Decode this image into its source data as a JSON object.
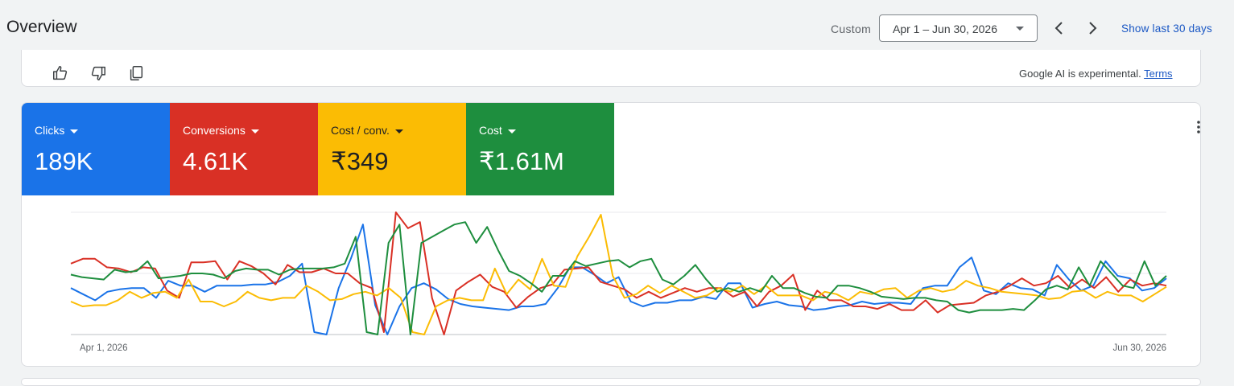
{
  "header": {
    "title": "Overview",
    "custom_label": "Custom",
    "date_range": "Apr 1 – Jun 30, 2026",
    "show_last": "Show last 30 days",
    "prev_icon": "chevron-left-icon",
    "next_icon": "chevron-right-icon"
  },
  "ai_feedback": {
    "icons": [
      "thumbs-up-icon",
      "thumbs-down-icon",
      "copy-icon"
    ],
    "note": "Google AI is experimental.",
    "terms_link": "Terms"
  },
  "metrics": [
    {
      "label": "Clicks",
      "value": "189K",
      "color": "#1a73e8"
    },
    {
      "label": "Conversions",
      "value": "4.61K",
      "color": "#d93025"
    },
    {
      "label": "Cost / conv.",
      "value": "₹349",
      "color": "#fbbc04"
    },
    {
      "label": "Cost",
      "value": "₹1.61M",
      "color": "#1e8e3e"
    }
  ],
  "chart_data": {
    "type": "line",
    "x_start_label": "Apr 1, 2026",
    "x_end_label": "Jun 30, 2026",
    "ylim": [
      0,
      100
    ],
    "grid": true,
    "series": [
      {
        "name": "Clicks",
        "color": "#1a73e8",
        "values": [
          38,
          33,
          28,
          35,
          37,
          38,
          38,
          30,
          44,
          40,
          40,
          35,
          40,
          40,
          40,
          41,
          41,
          43,
          48,
          58,
          2,
          0,
          38,
          62,
          90,
          24,
          0,
          23,
          38,
          42,
          37,
          29,
          25,
          23,
          22,
          21,
          20,
          23,
          23,
          25,
          38,
          55,
          55,
          49,
          42,
          47,
          27,
          23,
          26,
          26,
          28,
          28,
          31,
          29,
          42,
          42,
          22,
          25,
          27,
          24,
          23,
          20,
          21,
          23,
          24,
          27,
          25,
          26,
          26,
          25,
          38,
          40,
          40,
          55,
          63,
          36,
          33,
          42,
          38,
          37,
          32,
          57,
          45,
          36,
          40,
          60,
          48,
          46,
          36,
          38,
          46
        ]
      },
      {
        "name": "Conversions",
        "color": "#d93025",
        "values": [
          58,
          62,
          62,
          55,
          54,
          51,
          55,
          54,
          36,
          30,
          59,
          59,
          60,
          45,
          60,
          56,
          50,
          41,
          57,
          51,
          51,
          54,
          50,
          50,
          42,
          38,
          2,
          100,
          87,
          92,
          30,
          0,
          36,
          43,
          49,
          39,
          35,
          22,
          31,
          38,
          41,
          53,
          54,
          55,
          43,
          40,
          37,
          30,
          35,
          30,
          34,
          38,
          35,
          38,
          38,
          31,
          35,
          23,
          35,
          40,
          49,
          20,
          36,
          28,
          28,
          23,
          23,
          21,
          25,
          20,
          20,
          28,
          18,
          24,
          25,
          26,
          32,
          35,
          40,
          46,
          40,
          42,
          48,
          38,
          45,
          38,
          47,
          35,
          45,
          40,
          42,
          40
        ]
      },
      {
        "name": "Cost / conv.",
        "color": "#fbbc04",
        "values": [
          27,
          23,
          24,
          24,
          28,
          35,
          30,
          34,
          35,
          30,
          45,
          27,
          27,
          23,
          27,
          35,
          30,
          28,
          30,
          30,
          40,
          35,
          28,
          29,
          33,
          35,
          32,
          38,
          30,
          2,
          0,
          23,
          28,
          30,
          28,
          28,
          54,
          33,
          45,
          37,
          62,
          40,
          39,
          64,
          80,
          98,
          48,
          30,
          33,
          40,
          34,
          40,
          35,
          30,
          32,
          38,
          35,
          40,
          33,
          40,
          32,
          32,
          32,
          28,
          35,
          33,
          28,
          35,
          33,
          37,
          38,
          30,
          36,
          38,
          35,
          37,
          44,
          40,
          38,
          35,
          34,
          33,
          32,
          29,
          30,
          35,
          36,
          30,
          35,
          32,
          32,
          27,
          33,
          39
        ]
      },
      {
        "name": "Cost",
        "color": "#1e8e3e",
        "values": [
          49,
          47,
          46,
          45,
          53,
          51,
          52,
          60,
          46,
          47,
          48,
          50,
          50,
          49,
          46,
          52,
          54,
          53,
          53,
          49,
          53,
          54,
          54,
          54,
          55,
          58,
          80,
          2,
          0,
          75,
          90,
          0,
          75,
          80,
          85,
          90,
          92,
          75,
          88,
          69,
          52,
          48,
          42,
          35,
          48,
          48,
          60,
          56,
          58,
          60,
          61,
          55,
          60,
          62,
          45,
          41,
          48,
          57,
          45,
          35,
          38,
          35,
          38,
          35,
          48,
          38,
          38,
          34,
          31,
          30,
          40,
          40,
          38,
          35,
          31,
          30,
          29,
          30,
          30,
          28,
          27,
          20,
          18,
          20,
          20,
          20,
          21,
          20,
          28,
          37,
          40,
          37,
          55,
          40,
          60,
          50,
          40,
          38,
          60,
          40,
          48
        ]
      }
    ]
  }
}
